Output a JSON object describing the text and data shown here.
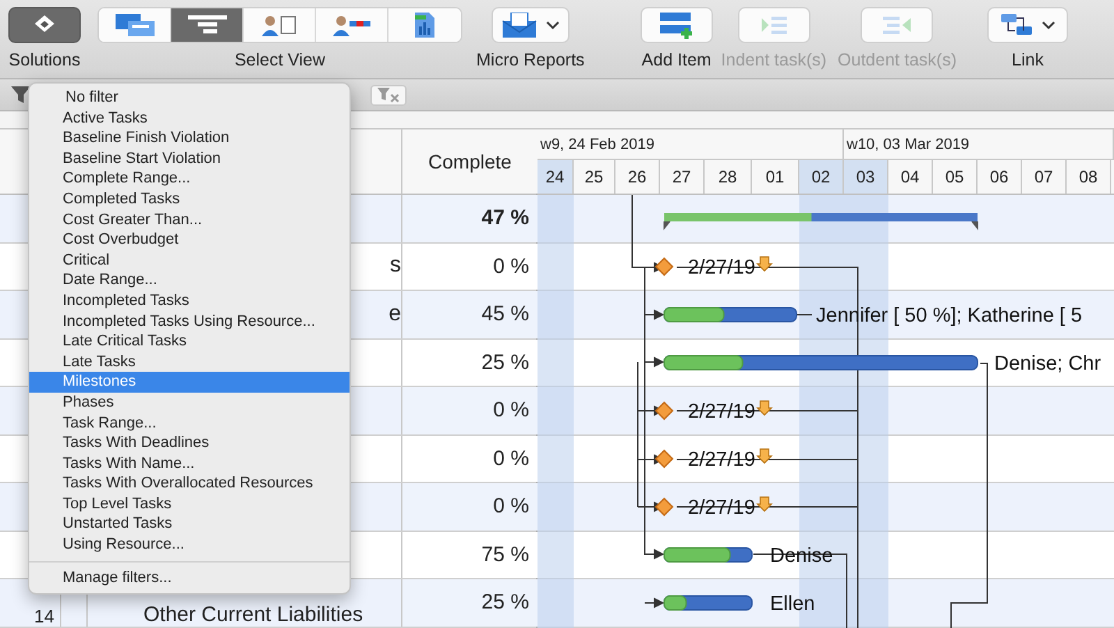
{
  "toolbar": {
    "groups": [
      {
        "kind": "single",
        "label": "Solutions",
        "selected": true,
        "disabled": false,
        "menu": false
      },
      {
        "kind": "segmented",
        "label": "Select View",
        "segments": [
          {
            "selected": false
          },
          {
            "selected": true
          },
          {
            "selected": false
          },
          {
            "selected": false
          },
          {
            "selected": false
          }
        ]
      },
      {
        "kind": "single",
        "label": "Micro Reports",
        "selected": false,
        "disabled": false,
        "menu": true
      },
      {
        "kind": "single",
        "label": "Add Item",
        "selected": false,
        "disabled": false,
        "menu": false
      },
      {
        "kind": "single",
        "label": "Indent task(s)",
        "selected": false,
        "disabled": true,
        "menu": false
      },
      {
        "kind": "single",
        "label": "Outdent task(s)",
        "selected": false,
        "disabled": true,
        "menu": false
      },
      {
        "kind": "single",
        "label": "Link",
        "selected": false,
        "disabled": false,
        "menu": true
      }
    ]
  },
  "table": {
    "columns": [
      {
        "label": "Complete"
      }
    ],
    "rows": [
      {
        "number": "",
        "name": "",
        "complete": "47 %",
        "summary": true
      },
      {
        "number": "",
        "name": "s",
        "complete": "0 %",
        "summary": false
      },
      {
        "number": "",
        "name": "e",
        "complete": "45 %",
        "summary": false
      },
      {
        "number": "",
        "name": "",
        "complete": "25 %",
        "summary": false
      },
      {
        "number": "",
        "name": "",
        "complete": "0 %",
        "summary": false
      },
      {
        "number": "",
        "name": "",
        "complete": "0 %",
        "summary": false
      },
      {
        "number": "",
        "name": "",
        "complete": "0 %",
        "summary": false
      },
      {
        "number": "",
        "name": "",
        "complete": "75 %",
        "summary": false
      },
      {
        "number": "14",
        "name": "Other Current Liabilities",
        "complete": "25 %",
        "summary": false
      }
    ]
  },
  "gantt": {
    "weeks": [
      "w9, 24 Feb 2019",
      "w10, 03 Mar 2019"
    ],
    "days": [
      {
        "label": "24",
        "weekend": true
      },
      {
        "label": "25",
        "weekend": false
      },
      {
        "label": "26",
        "weekend": false
      },
      {
        "label": "27",
        "weekend": false
      },
      {
        "label": "28",
        "weekend": false
      },
      {
        "label": "01",
        "weekend": false
      },
      {
        "label": "02",
        "weekend": true
      },
      {
        "label": "03",
        "weekend": true
      },
      {
        "label": "04",
        "weekend": false
      },
      {
        "label": "05",
        "weekend": false
      },
      {
        "label": "06",
        "weekend": false
      },
      {
        "label": "07",
        "weekend": false
      },
      {
        "label": "08",
        "weekend": false
      }
    ],
    "bars": [
      {
        "kind": "summary",
        "level": 0.47
      },
      {
        "kind": "milestone",
        "label": "2/27/19"
      },
      {
        "kind": "task",
        "level": 0.45,
        "label": "Jennifer [ 50 %]; Katherine [ 5"
      },
      {
        "kind": "task",
        "level": 0.25,
        "label": "Denise; Chr"
      },
      {
        "kind": "milestone",
        "label": "2/27/19"
      },
      {
        "kind": "milestone",
        "label": "2/27/19"
      },
      {
        "kind": "milestone",
        "label": "2/27/19"
      },
      {
        "kind": "task",
        "level": 0.75,
        "label": "Denise"
      },
      {
        "kind": "task",
        "level": 0.25,
        "label": "Ellen"
      }
    ]
  },
  "filter_menu": {
    "items": [
      {
        "label": "No filter",
        "selected": false
      },
      {
        "label": "Active Tasks",
        "selected": false
      },
      {
        "label": "Baseline Finish Violation",
        "selected": false
      },
      {
        "label": "Baseline Start Violation",
        "selected": false
      },
      {
        "label": "Complete Range...",
        "selected": false
      },
      {
        "label": "Completed Tasks",
        "selected": false
      },
      {
        "label": "Cost Greater Than...",
        "selected": false
      },
      {
        "label": "Cost Overbudget",
        "selected": false
      },
      {
        "label": "Critical",
        "selected": false
      },
      {
        "label": "Date Range...",
        "selected": false
      },
      {
        "label": "Incompleted Tasks",
        "selected": false
      },
      {
        "label": "Incompleted Tasks Using Resource...",
        "selected": false
      },
      {
        "label": "Late Critical Tasks",
        "selected": false
      },
      {
        "label": "Late Tasks",
        "selected": false
      },
      {
        "label": "Milestones",
        "selected": true
      },
      {
        "label": "Phases",
        "selected": false
      },
      {
        "label": "Task Range...",
        "selected": false
      },
      {
        "label": "Tasks With Deadlines",
        "selected": false
      },
      {
        "label": "Tasks With Name...",
        "selected": false
      },
      {
        "label": "Tasks With Overallocated Resources",
        "selected": false
      },
      {
        "label": "Top Level Tasks",
        "selected": false
      },
      {
        "label": "Unstarted Tasks",
        "selected": false
      },
      {
        "label": "Using Resource...",
        "selected": false
      }
    ],
    "footer": "Manage filters..."
  }
}
